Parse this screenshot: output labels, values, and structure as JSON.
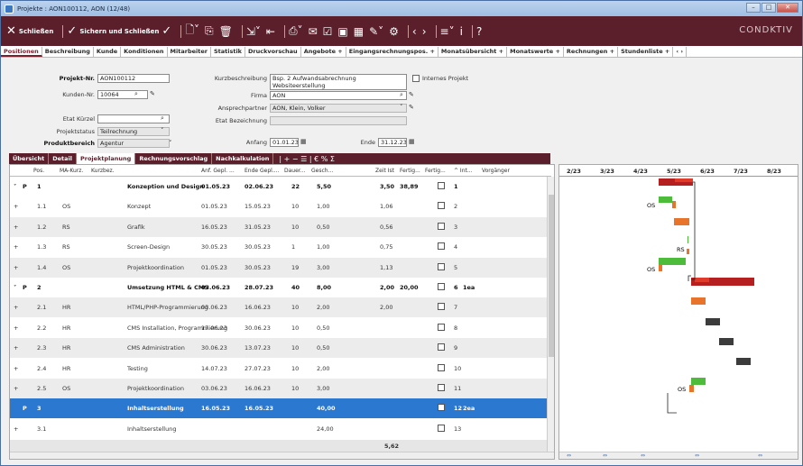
{
  "window": {
    "title": "Projekte : AON100112, AON (12/48)"
  },
  "toolbar": {
    "close_label": "Schließen",
    "save_close_label": "Sichern und Schließen",
    "brand": "CONDKTIV"
  },
  "tabs": [
    "Positionen",
    "Beschreibung",
    "Kunde",
    "Konditionen",
    "Mitarbeiter",
    "Statistik",
    "Druckvorschau",
    "Angebote +",
    "Eingangsrechnungspos. +",
    "Monatsübersicht +",
    "Monatswerte +",
    "Rechnungen +",
    "Stundenliste +",
    "‹ ›"
  ],
  "form": {
    "projekt_nr_label": "Projekt-Nr.",
    "projekt_nr": "AON100112",
    "kunden_nr_label": "Kunden-Nr.",
    "kunden_nr": "10064",
    "etat_kuerzel_label": "Etat Kürzel",
    "etat_kuerzel": "",
    "projektstatus_label": "Projektstatus",
    "projektstatus": "Teilrechnung",
    "produktbereich_label": "Produktbereich",
    "produktbereich": "Agentur",
    "kurzbeschreibung_label": "Kurzbeschreibung",
    "kurzbeschreibung_1": "Bsp. 2 Aufwandsabrechnung",
    "kurzbeschreibung_2": "Websiteerstellung",
    "internes_projekt_label": "Internes Projekt",
    "firma_label": "Firma",
    "firma": "AON",
    "ansprechpartner_label": "Ansprechpartner",
    "ansprechpartner": "AON, Klein, Volker",
    "etat_bezeichnung_label": "Etat Bezeichnung",
    "etat_bezeichnung": "",
    "anfang_label": "Anfang",
    "anfang": "01.01.23",
    "ende_label": "Ende",
    "ende": "31.12.23"
  },
  "subtabs": [
    "Übersicht",
    "Detail",
    "Projektplanung",
    "Rechnungsvorschlag",
    "Nachkalkulation"
  ],
  "subtab_tools": "| + − ☰ | € % Σ",
  "grid": {
    "headers": {
      "pos": "Pos.",
      "ma": "MA-Kurz.",
      "kurz": "Kurzbez.",
      "anf": "Anf. Gepl. ...",
      "ende": "Ende Gepl....",
      "dauer": "Dauer...",
      "gesch": "Gesch...",
      "zeit": "Zeit Ist",
      "fertig1": "Fertig...",
      "fertig2": "Fertig...",
      "int": "^ Int...",
      "vorg": "Vorgänger"
    },
    "rows": [
      {
        "exp": "˅",
        "p": "P",
        "pos": "1",
        "ma": "",
        "kurz": "Konzeption und Design",
        "anf": "01.05.23",
        "ende": "02.06.23",
        "dauer": "22",
        "gesch": "5,50",
        "zeit": "3,50",
        "fertig": "38,89",
        "int": "1",
        "vorg": "",
        "style": "bold"
      },
      {
        "exp": "+",
        "p": "",
        "pos": "1.1",
        "ma": "OS",
        "kurz": "Konzept",
        "anf": "01.05.23",
        "ende": "15.05.23",
        "dauer": "10",
        "gesch": "1,00",
        "zeit": "1,06",
        "fertig": "",
        "int": "2",
        "vorg": "",
        "style": ""
      },
      {
        "exp": "+",
        "p": "",
        "pos": "1.2",
        "ma": "RS",
        "kurz": "Grafik",
        "anf": "16.05.23",
        "ende": "31.05.23",
        "dauer": "10",
        "gesch": "0,50",
        "zeit": "0,56",
        "fertig": "",
        "int": "3",
        "vorg": "",
        "style": "alt"
      },
      {
        "exp": "+",
        "p": "",
        "pos": "1.3",
        "ma": "RS",
        "kurz": "Screen-Design",
        "anf": "30.05.23",
        "ende": "30.05.23",
        "dauer": "1",
        "gesch": "1,00",
        "zeit": "0,75",
        "fertig": "",
        "int": "4",
        "vorg": "",
        "style": ""
      },
      {
        "exp": "+",
        "p": "",
        "pos": "1.4",
        "ma": "OS",
        "kurz": "Projektkoordination",
        "anf": "01.05.23",
        "ende": "30.05.23",
        "dauer": "19",
        "gesch": "3,00",
        "zeit": "1,13",
        "fertig": "",
        "int": "5",
        "vorg": "",
        "style": "alt"
      },
      {
        "exp": "˅",
        "p": "P",
        "pos": "2",
        "ma": "",
        "kurz": "Umsetzung HTML & CMS",
        "anf": "03.06.23",
        "ende": "28.07.23",
        "dauer": "40",
        "gesch": "8,00",
        "zeit": "2,00",
        "fertig": "20,00",
        "int": "6",
        "vorg": "1ea",
        "style": "bold"
      },
      {
        "exp": "+",
        "p": "",
        "pos": "2.1",
        "ma": "HR",
        "kurz": "HTML/PHP-Programmierung",
        "anf": "03.06.23",
        "ende": "16.06.23",
        "dauer": "10",
        "gesch": "2,00",
        "zeit": "2,00",
        "fertig": "",
        "int": "7",
        "vorg": "",
        "style": "alt"
      },
      {
        "exp": "+",
        "p": "",
        "pos": "2.2",
        "ma": "HR",
        "kurz": "CMS Installation, Programmierung",
        "anf": "17.06.23",
        "ende": "30.06.23",
        "dauer": "10",
        "gesch": "0,50",
        "zeit": "",
        "fertig": "",
        "int": "8",
        "vorg": "",
        "style": ""
      },
      {
        "exp": "+",
        "p": "",
        "pos": "2.3",
        "ma": "HR",
        "kurz": "CMS Administration",
        "anf": "30.06.23",
        "ende": "13.07.23",
        "dauer": "10",
        "gesch": "0,50",
        "zeit": "",
        "fertig": "",
        "int": "9",
        "vorg": "",
        "style": "alt"
      },
      {
        "exp": "+",
        "p": "",
        "pos": "2.4",
        "ma": "HR",
        "kurz": "Testing",
        "anf": "14.07.23",
        "ende": "27.07.23",
        "dauer": "10",
        "gesch": "2,00",
        "zeit": "",
        "fertig": "",
        "int": "10",
        "vorg": "",
        "style": ""
      },
      {
        "exp": "+",
        "p": "",
        "pos": "2.5",
        "ma": "OS",
        "kurz": "Projektkoordination",
        "anf": "03.06.23",
        "ende": "16.06.23",
        "dauer": "10",
        "gesch": "3,00",
        "zeit": "",
        "fertig": "",
        "int": "11",
        "vorg": "",
        "style": "alt"
      },
      {
        "exp": "",
        "p": "P",
        "pos": "3",
        "ma": "",
        "kurz": "Inhaltserstellung",
        "anf": "16.05.23",
        "ende": "16.05.23",
        "dauer": "",
        "gesch": "40,00",
        "zeit": "",
        "fertig": "",
        "int": "12",
        "vorg": "2ea",
        "style": "sel"
      },
      {
        "exp": "+",
        "p": "",
        "pos": "3.1",
        "ma": "",
        "kurz": "Inhaltserstellung",
        "anf": "",
        "ende": "",
        "dauer": "",
        "gesch": "24,00",
        "zeit": "",
        "fertig": "",
        "int": "13",
        "vorg": "",
        "style": ""
      }
    ],
    "total_zeit": "5,62"
  },
  "gantt": {
    "months": [
      "2/23",
      "3/23",
      "4/23",
      "5/23",
      "6/23",
      "7/23",
      "8/23"
    ],
    "labels": [
      "OS",
      "RS",
      "OS",
      "OS"
    ],
    "colors": {
      "darkred": "#b51f1f",
      "red": "#e03a2a",
      "green": "#4cbc3a",
      "orange": "#e8732a",
      "gray": "#3c3c3c"
    }
  }
}
